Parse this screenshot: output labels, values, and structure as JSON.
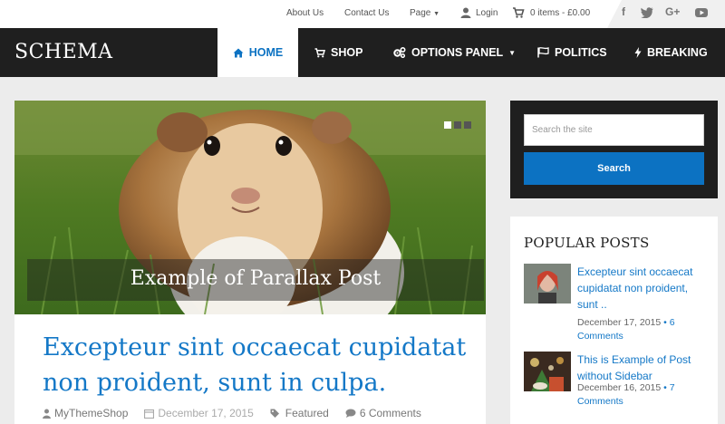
{
  "topbar": {
    "links": [
      "About Us",
      "Contact Us",
      "Page"
    ],
    "login": "Login",
    "cart": "0 items - £0.00",
    "social": [
      "f",
      "twitter-icon",
      "G+",
      "youtube-icon"
    ]
  },
  "header": {
    "logo": "SCHEMA",
    "nav": [
      {
        "label": "HOME",
        "icon": "home-icon"
      },
      {
        "label": "SHOP",
        "icon": "cart-icon"
      },
      {
        "label": "OPTIONS PANEL",
        "icon": "gears-icon"
      },
      {
        "label": "POLITICS",
        "icon": "flag-icon"
      },
      {
        "label": "BREAKING",
        "icon": "bolt-icon"
      }
    ]
  },
  "slider": {
    "caption": "Example of Parallax Post"
  },
  "post": {
    "title": "Excepteur sint occaecat cupidatat non proident, sunt in culpa.",
    "author": "MyThemeShop",
    "date": "December 17, 2015",
    "category": "Featured",
    "comments": "6 Comments"
  },
  "sidebar": {
    "search_placeholder": "Search the site",
    "search_button": "Search",
    "popular_title": "POPULAR POSTS",
    "posts": [
      {
        "title": "Excepteur sint occaecat cupidatat non proident, sunt ..",
        "date": "December 17, 2015",
        "comments": "6 Comments"
      },
      {
        "title": "This is Example of Post without Sidebar",
        "date": "December 16, 2015",
        "comments": "7 Comments"
      }
    ]
  }
}
